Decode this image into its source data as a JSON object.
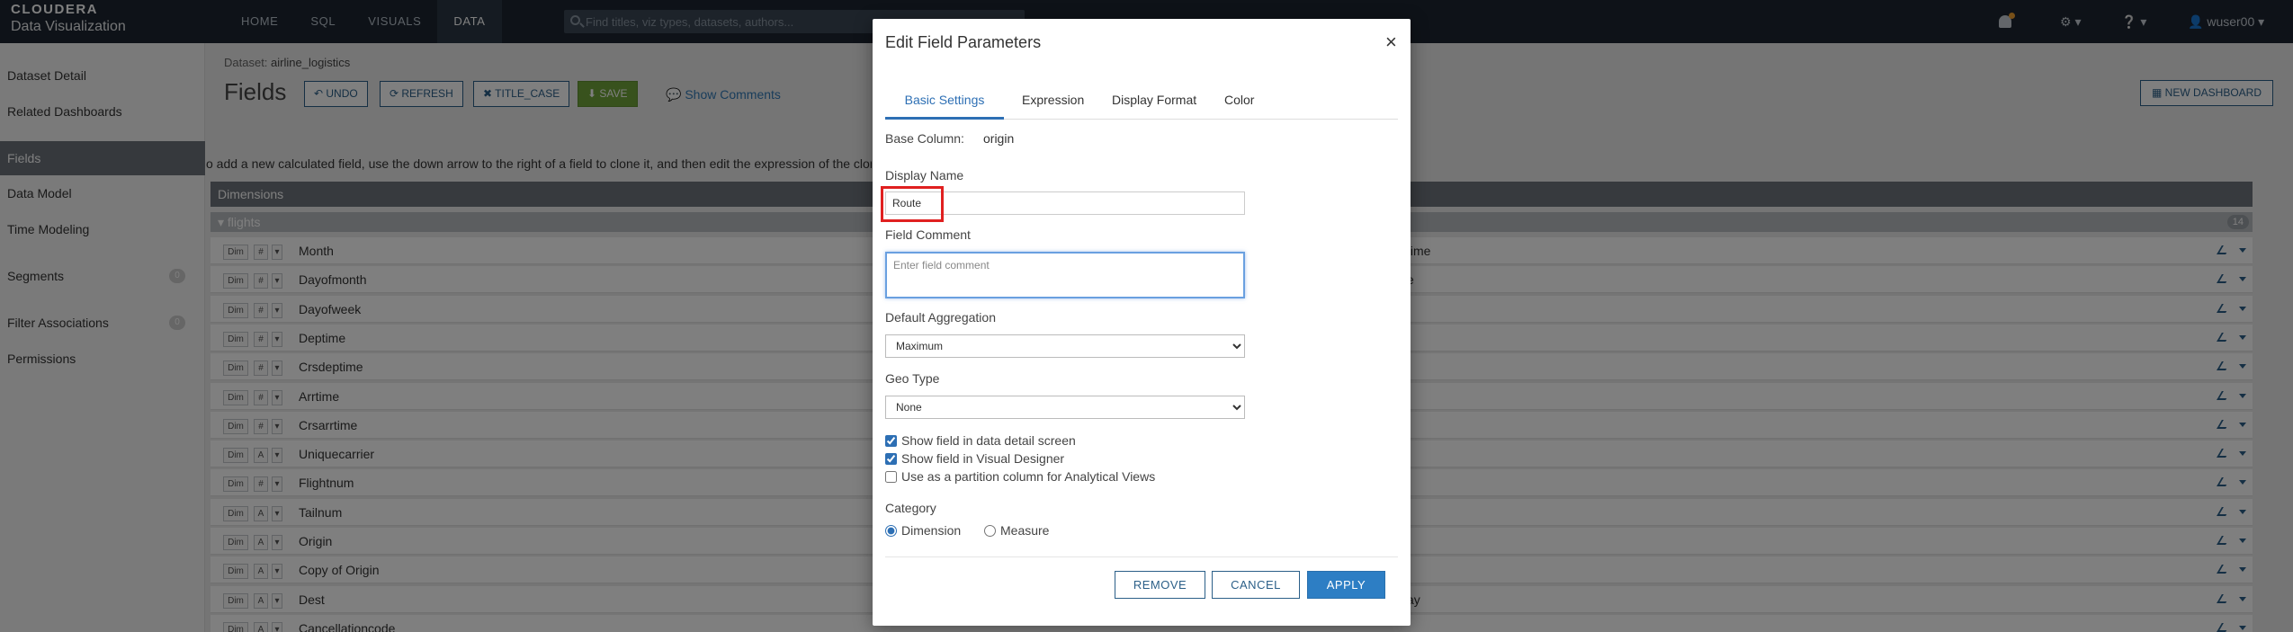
{
  "app": {
    "brand_top": "CLOUDERA",
    "brand_bottom": "Data Visualization",
    "nav": [
      "HOME",
      "SQL",
      "VISUALS",
      "DATA"
    ],
    "active_nav": "DATA",
    "search_placeholder": "Find titles, viz types, datasets, authors...",
    "user": "wuser00"
  },
  "sidebar": {
    "items": [
      {
        "label": "Dataset Detail"
      },
      {
        "label": "Related Dashboards"
      },
      {
        "label": "Fields",
        "active": true
      },
      {
        "label": "Data Model"
      },
      {
        "label": "Time Modeling"
      },
      {
        "label": "Segments",
        "badge": "0"
      },
      {
        "label": "Filter Associations",
        "badge": "0"
      },
      {
        "label": "Permissions"
      }
    ]
  },
  "page": {
    "dataset_prefix": "Dataset:",
    "dataset_name": "airline_logistics",
    "title": "Fields",
    "buttons": {
      "undo": "UNDO",
      "refresh": "REFRESH",
      "title_case": "TITLE_CASE",
      "save": "SAVE",
      "show_comments": "Show Comments",
      "new_dashboard": "NEW DASHBOARD"
    },
    "hint": "o add a new calculated field, use the down arrow to the right of a field to clone it, and then edit the expression of the cloned",
    "dimensions_label": "Dimensions",
    "table_label": "flights",
    "table_count": "14",
    "fields": [
      {
        "dim": "Dim",
        "type": "#",
        "name": "Month",
        "right": "time"
      },
      {
        "dim": "Dim",
        "type": "#",
        "name": "Dayofmonth",
        "right": "e"
      },
      {
        "dim": "Dim",
        "type": "#",
        "name": "Dayofweek",
        "right": ""
      },
      {
        "dim": "Dim",
        "type": "#",
        "name": "Deptime",
        "right": ""
      },
      {
        "dim": "Dim",
        "type": "#",
        "name": "Crsdeptime",
        "right": ""
      },
      {
        "dim": "Dim",
        "type": "#",
        "name": "Arrtime",
        "right": ""
      },
      {
        "dim": "Dim",
        "type": "#",
        "name": "Crsarrtime",
        "right": ""
      },
      {
        "dim": "Dim",
        "type": "A",
        "name": "Uniquecarrier",
        "right": ""
      },
      {
        "dim": "Dim",
        "type": "#",
        "name": "Flightnum",
        "right": ""
      },
      {
        "dim": "Dim",
        "type": "A",
        "name": "Tailnum",
        "right": ""
      },
      {
        "dim": "Dim",
        "type": "A",
        "name": "Origin",
        "right": ""
      },
      {
        "dim": "Dim",
        "type": "A",
        "name": "Copy of Origin",
        "right": ""
      },
      {
        "dim": "Dim",
        "type": "A",
        "name": "Dest",
        "right": "ay"
      },
      {
        "dim": "Dim",
        "type": "A",
        "name": "Cancellationcode",
        "right": ""
      }
    ]
  },
  "modal": {
    "title": "Edit Field Parameters",
    "close": "×",
    "tabs": [
      "Basic Settings",
      "Expression",
      "Display Format",
      "Color"
    ],
    "base_column_label": "Base Column:",
    "base_column_value": "origin",
    "display_name_label": "Display Name",
    "display_name_value": "Route",
    "field_comment_label": "Field Comment",
    "field_comment_placeholder": "Enter field comment",
    "default_aggregation_label": "Default Aggregation",
    "default_aggregation_value": "Maximum",
    "geo_type_label": "Geo Type",
    "geo_type_value": "None",
    "checkboxes": [
      {
        "label": "Show field in data detail screen",
        "checked": true
      },
      {
        "label": "Show field in Visual Designer",
        "checked": true
      },
      {
        "label": "Use as a partition column for Analytical Views",
        "checked": false
      }
    ],
    "category_label": "Category",
    "category_options": [
      "Dimension",
      "Measure"
    ],
    "category_selected": "Dimension",
    "buttons": {
      "remove": "REMOVE",
      "cancel": "CANCEL",
      "apply": "APPLY"
    }
  },
  "colors": {
    "accent": "#2d6fb4",
    "highlight": "#e02020",
    "nav_bg": "#1c2530",
    "save": "#70a53a"
  }
}
